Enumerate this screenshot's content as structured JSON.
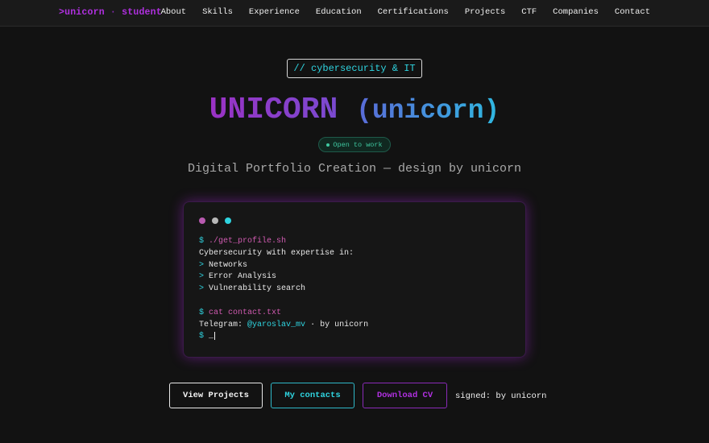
{
  "header": {
    "logo_main": ">unicorn",
    "logo_sep": "·",
    "logo_role": "student",
    "nav": [
      "About",
      "Skills",
      "Experience",
      "Education",
      "Certifications",
      "Projects",
      "CTF",
      "Companies",
      "Contact"
    ]
  },
  "hero": {
    "tag": "// cybersecurity & IT",
    "name": "UNICORN",
    "handle": "(unicorn)",
    "status": "Open to work",
    "subtitle": "Digital Portfolio Creation — design by unicorn"
  },
  "terminal": {
    "dot_colors": [
      "#b85ab0",
      "#b8b8b8",
      "#2fd4e0"
    ],
    "prompt": "$",
    "cmd1": "./get_profile.sh",
    "line1": "Cybersecurity with expertise in:",
    "bullet": ">",
    "items": [
      "Networks",
      "Error Analysis",
      "Vulnerability search"
    ],
    "cmd2": "cat contact.txt",
    "telegram_label": "Telegram:",
    "telegram_handle": "@yaroslav_mv",
    "telegram_suffix": "· by unicorn",
    "cursor": "_"
  },
  "actions": {
    "view_projects": "View Projects",
    "my_contacts": "My contacts",
    "download_cv": "Download CV",
    "signed": "signed: by unicorn"
  },
  "colors": {
    "accent_purple": "#b030e0",
    "accent_cyan": "#2fd4e0",
    "status_green": "#3fc8a0",
    "background": "#121212"
  }
}
